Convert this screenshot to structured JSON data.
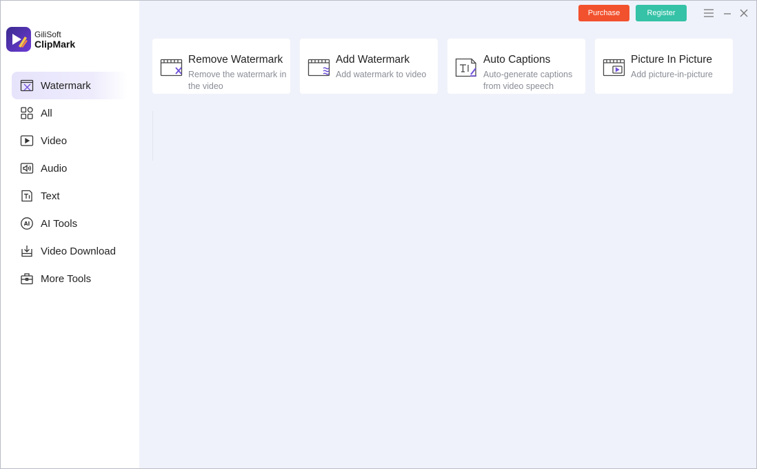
{
  "app": {
    "brand": "GiliSoft",
    "product": "ClipMark"
  },
  "header": {
    "purchase_label": "Purchase",
    "register_label": "Register"
  },
  "sidebar": {
    "items": [
      {
        "label": "Watermark",
        "icon": "watermark-icon",
        "active": true
      },
      {
        "label": "All",
        "icon": "grid-icon",
        "active": false
      },
      {
        "label": "Video",
        "icon": "video-icon",
        "active": false
      },
      {
        "label": "Audio",
        "icon": "audio-icon",
        "active": false
      },
      {
        "label": "Text",
        "icon": "text-icon",
        "active": false
      },
      {
        "label": "AI Tools",
        "icon": "ai-icon",
        "active": false
      },
      {
        "label": "Video Download",
        "icon": "download-icon",
        "active": false
      },
      {
        "label": "More Tools",
        "icon": "toolbox-icon",
        "active": false
      }
    ]
  },
  "tools": [
    {
      "title": "Remove Watermark",
      "desc": "Remove the watermark in the video",
      "icon": "remove-watermark-icon"
    },
    {
      "title": "Add Watermark",
      "desc": "Add watermark to video",
      "icon": "add-watermark-icon"
    },
    {
      "title": "Auto Captions",
      "desc": "Auto-generate captions from video speech",
      "icon": "auto-captions-icon"
    },
    {
      "title": "Picture In Picture",
      "desc": "Add picture-in-picture",
      "icon": "picture-in-picture-icon"
    }
  ],
  "colors": {
    "accent": "#6f4fd8",
    "purchase": "#f2512d",
    "register": "#35c2a7",
    "main_bg": "#f0f2fb"
  }
}
